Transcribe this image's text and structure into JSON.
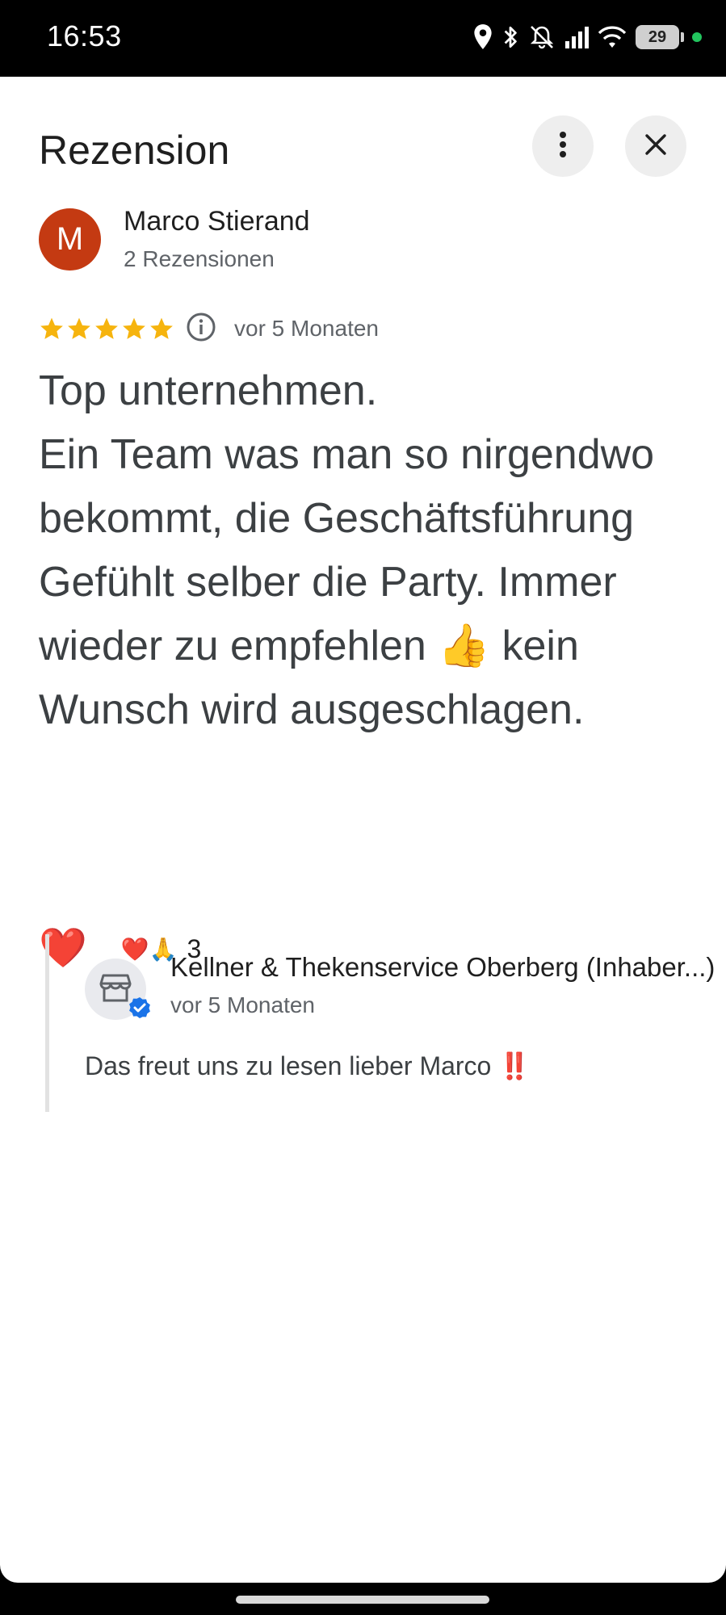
{
  "status_bar": {
    "time": "16:53",
    "battery_level": "29",
    "icons": [
      "location-icon",
      "bluetooth-icon",
      "bell-off-icon",
      "signal-icon",
      "wifi-icon",
      "battery-icon"
    ]
  },
  "header": {
    "title": "Rezension",
    "more_icon": "more-vert-icon",
    "close_icon": "close-icon"
  },
  "review": {
    "author_initial": "M",
    "author_name": "Marco Stierand",
    "author_meta": "2 Rezensionen",
    "avatar_color": "#c43a12",
    "rating": 5,
    "rating_max": 5,
    "date": "vor 5 Monaten",
    "text": "Top unternehmen.\nEin Team was man so nirgendwo bekommt, die Geschäftsführung Gefühlt selber die Party. Immer wieder zu empfehlen 👍 kein Wunsch wird ausgeschlagen."
  },
  "reactions": {
    "heart": "❤️",
    "emojis": "❤️🙏",
    "count": "3"
  },
  "owner_reply": {
    "name": "Kellner & Thekenservice Oberberg (Inhaber...)",
    "date": "vor 5 Monaten",
    "text": "Das freut uns zu lesen lieber Marco ‼️",
    "icon": "storefront-icon",
    "verified_icon": "verified-icon"
  },
  "colors": {
    "star": "#f6b40e",
    "accent_blue": "#1a73e8",
    "text_primary": "#1f1f1f",
    "text_secondary": "#5f6368"
  }
}
